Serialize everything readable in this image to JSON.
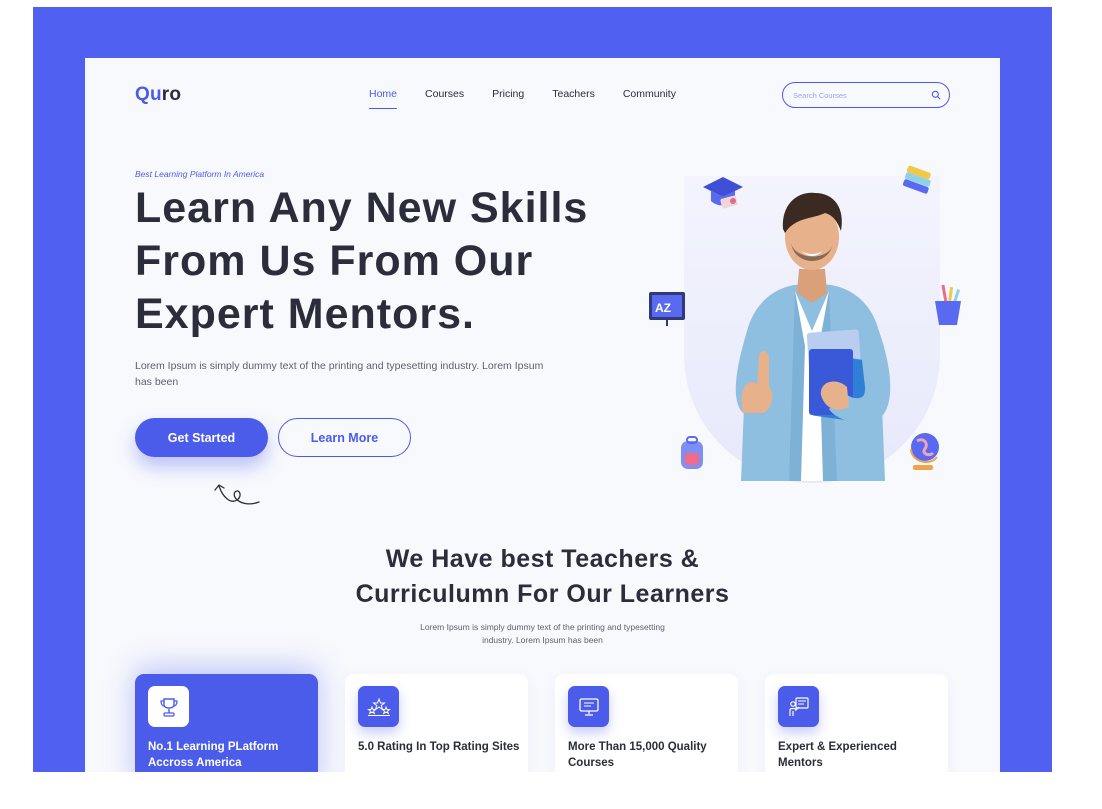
{
  "brand": {
    "logo_first": "Qu",
    "logo_rest": "ro"
  },
  "nav": {
    "items": [
      {
        "label": "Home",
        "active": true
      },
      {
        "label": "Courses",
        "active": false
      },
      {
        "label": "Pricing",
        "active": false
      },
      {
        "label": "Teachers",
        "active": false
      },
      {
        "label": "Community",
        "active": false
      }
    ]
  },
  "search": {
    "placeholder": "Search Courses",
    "value": "",
    "icon": "search-icon"
  },
  "hero": {
    "eyebrow": "Best Learning Platform In America",
    "title_line1": "Learn Any New Skills",
    "title_line2": "From Us From Our",
    "title_line3": "Expert Mentors.",
    "description": "Lorem Ipsum is simply dummy text of the printing and typesetting industry. Lorem Ipsum has been",
    "primary_button": "Get Started",
    "secondary_button": "Learn More"
  },
  "features": {
    "title_line1": "We Have best Teachers &",
    "title_line2": "Curriculumn For Our Learners",
    "description": "Lorem Ipsum is simply dummy text of the printing and typesetting industry. Lorem Ipsum has been",
    "cards": [
      {
        "title": "No.1 Learning PLatform Accross America",
        "icon": "trophy-icon",
        "featured": true
      },
      {
        "title": "5.0 Rating In Top Rating Sites",
        "icon": "rating-stars-icon",
        "featured": false
      },
      {
        "title": "More Than 15,000 Quality Courses",
        "icon": "monitor-course-icon",
        "featured": false
      },
      {
        "title": "Expert & Experienced Mentors",
        "icon": "mentor-board-icon",
        "featured": false
      }
    ]
  },
  "colors": {
    "accent": "#4b5bea",
    "frame": "#5060f0",
    "page_bg": "#f8f9fd",
    "text": "#2b2d3a"
  }
}
